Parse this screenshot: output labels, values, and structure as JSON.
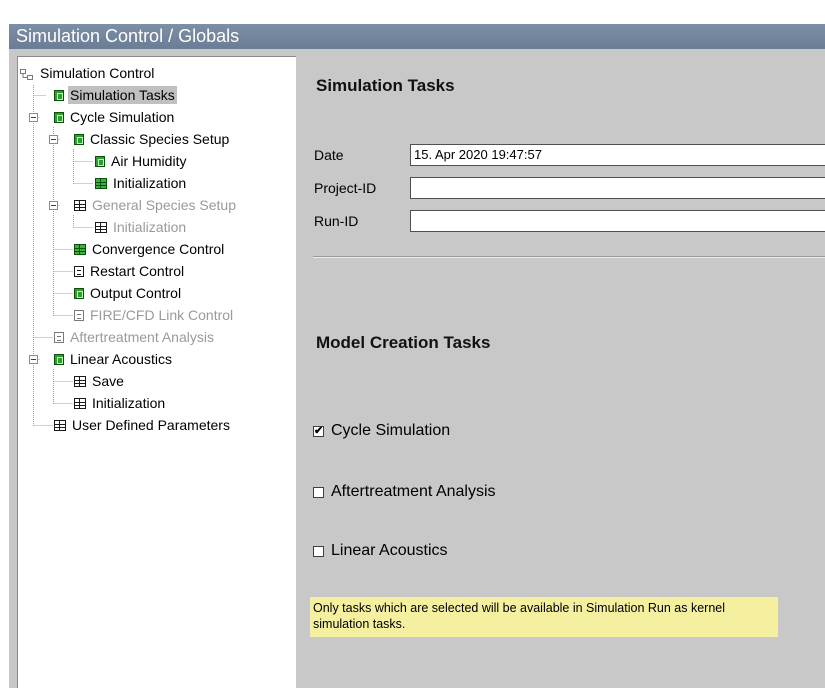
{
  "window": {
    "title": "Simulation Control / Globals"
  },
  "tree": {
    "items": [
      {
        "label": "Simulation Control"
      },
      {
        "label": "Simulation Tasks"
      },
      {
        "label": "Cycle Simulation"
      },
      {
        "label": "Classic Species Setup"
      },
      {
        "label": "Air Humidity"
      },
      {
        "label": "Initialization"
      },
      {
        "label": "General Species Setup"
      },
      {
        "label": "Initialization"
      },
      {
        "label": "Convergence Control"
      },
      {
        "label": "Restart Control"
      },
      {
        "label": "Output Control"
      },
      {
        "label": "FIRE/CFD Link Control"
      },
      {
        "label": "Aftertreatment Analysis"
      },
      {
        "label": "Linear Acoustics"
      },
      {
        "label": "Save"
      },
      {
        "label": "Initialization"
      },
      {
        "label": "User Defined Parameters"
      }
    ],
    "selected_item": "Simulation Tasks"
  },
  "main": {
    "simulation_tasks_heading": "Simulation Tasks",
    "date_label": "Date",
    "date_value": "15. Apr 2020 19:47:57",
    "project_id_label": "Project-ID",
    "project_id_value": "",
    "run_id_label": "Run-ID",
    "run_id_value": "",
    "model_creation_heading": "Model Creation Tasks",
    "tasks": [
      {
        "label": "Cycle Simulation",
        "checked": true,
        "mark": "✔"
      },
      {
        "label": "Aftertreatment Analysis",
        "checked": false,
        "mark": ""
      },
      {
        "label": "Linear Acoustics",
        "checked": false,
        "mark": ""
      }
    ],
    "note": "Only tasks which are selected will be available in Simulation Run as kernel simulation tasks."
  },
  "colors": {
    "titlebar": "#6f8299",
    "panel_background": "#c8c8c8",
    "note_background": "#f5f0a0",
    "selection": "#c0c0c0"
  }
}
